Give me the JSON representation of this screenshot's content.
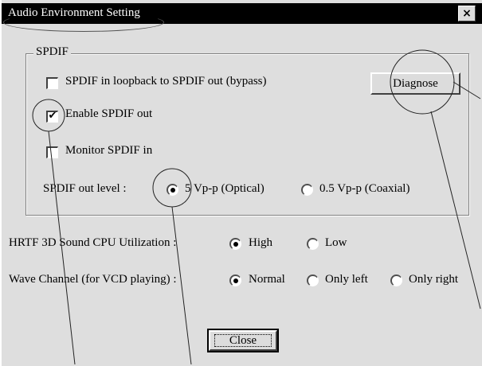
{
  "window": {
    "title": "Audio Environment Setting",
    "close_glyph": "×"
  },
  "spdif": {
    "group_label": "SPDIF",
    "loopback": {
      "label": "SPDIF in loopback to SPDIF out (bypass)",
      "checked": false
    },
    "enable_out": {
      "label": "Enable SPDIF out",
      "checked": true
    },
    "monitor_in": {
      "label": "Monitor SPDIF in",
      "checked": false
    },
    "diagnose_label": "Diagnose",
    "out_level": {
      "label": "SPDIF out level :",
      "options": [
        "5 Vp-p (Optical)",
        "0.5 Vp-p (Coaxial)"
      ],
      "selected": "5 Vp-p (Optical)"
    }
  },
  "hrtf": {
    "label": "HRTF 3D Sound CPU Utilization :",
    "options": [
      "High",
      "Low"
    ],
    "selected": "High"
  },
  "wave_channel": {
    "label": "Wave Channel (for VCD playing) :",
    "options": [
      "Normal",
      "Only left",
      "Only right"
    ],
    "selected": "Normal"
  },
  "footer": {
    "close_label": "Close"
  },
  "colors": {
    "title_bar": "#000000",
    "dialog_face": "#dedede"
  }
}
